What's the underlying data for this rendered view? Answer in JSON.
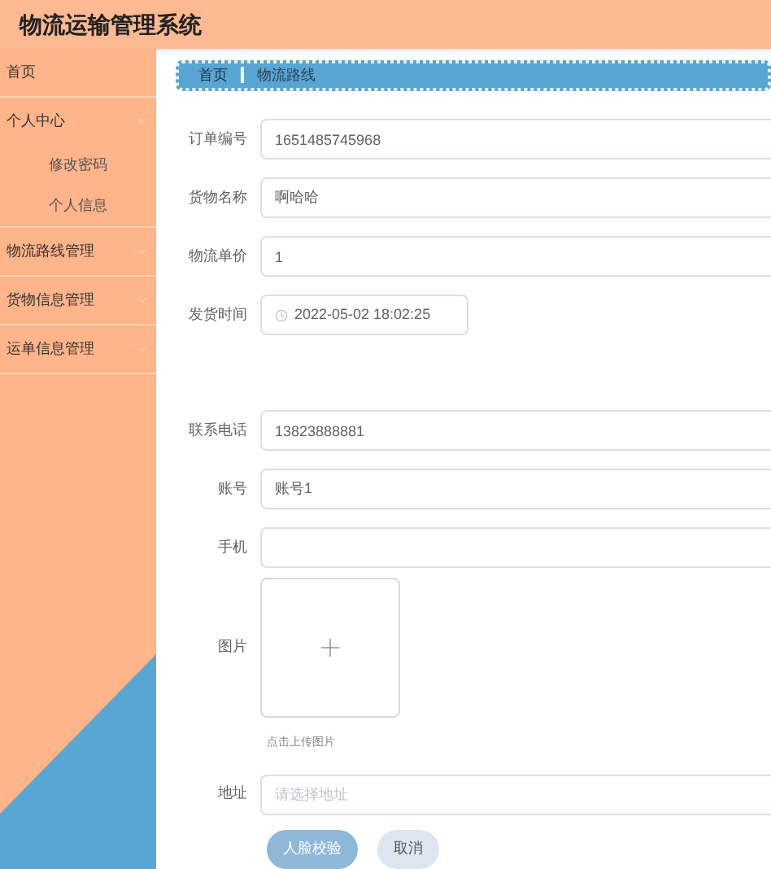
{
  "header": {
    "title": "物流运输管理系统"
  },
  "sidebar": {
    "items": [
      {
        "label": "首页",
        "kind": "link"
      },
      {
        "label": "个人中心",
        "kind": "group",
        "children": [
          {
            "label": "修改密码"
          },
          {
            "label": "个人信息"
          }
        ]
      },
      {
        "label": "物流路线管理",
        "kind": "group"
      },
      {
        "label": "货物信息管理",
        "kind": "group"
      },
      {
        "label": "运单信息管理",
        "kind": "group"
      }
    ]
  },
  "breadcrumb": [
    "首页",
    "物流路线"
  ],
  "form": {
    "fields": [
      {
        "kind": "text",
        "label": "订单编号",
        "value": "1651485745968"
      },
      {
        "kind": "text",
        "label": "货物名称",
        "value": "啊哈哈"
      },
      {
        "kind": "text",
        "label": "物流单价",
        "value": "1"
      },
      {
        "kind": "date",
        "label": "发货时间",
        "value": "2022-05-02 18:02:25"
      },
      {
        "kind": "spacer"
      },
      {
        "kind": "text",
        "label": "联系电话",
        "value": "13823888881"
      },
      {
        "kind": "text",
        "label": "账号",
        "value": "账号1"
      },
      {
        "kind": "text",
        "label": "手机"
      },
      {
        "kind": "upload",
        "label": "图片",
        "hint": "点击上传图片"
      },
      {
        "kind": "text",
        "label": "地址",
        "placeholder": "请选择地址"
      }
    ],
    "buttons": [
      {
        "label": "人脸校验",
        "kind": "primary"
      },
      {
        "label": "取消",
        "kind": "secondary"
      }
    ]
  }
}
